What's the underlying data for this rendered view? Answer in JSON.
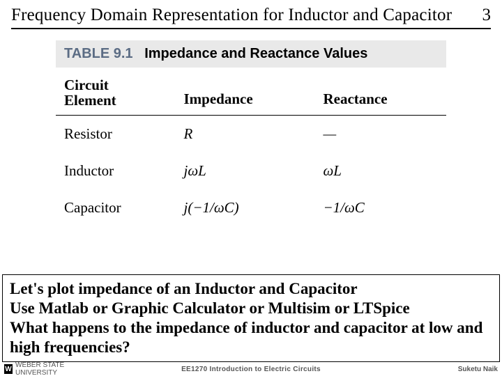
{
  "header": {
    "title": "Frequency Domain Representation for Inductor and Capacitor",
    "page_number": "3"
  },
  "table": {
    "caption_label": "TABLE 9.1",
    "caption_text": "Impedance and Reactance Values",
    "columns": {
      "col1_line1": "Circuit",
      "col1_line2": "Element",
      "col2": "Impedance",
      "col3": "Reactance"
    },
    "rows": [
      {
        "element": "Resistor",
        "impedance": "R",
        "reactance": "—"
      },
      {
        "element": "Inductor",
        "impedance": "jωL",
        "reactance": "ωL"
      },
      {
        "element": "Capacitor",
        "impedance": "j(−1/ωC)",
        "reactance": "−1/ωC"
      }
    ]
  },
  "callout": {
    "line1": "Let's plot impedance of an Inductor and Capacitor",
    "line2": "Use Matlab  or Graphic Calculator or Multisim or LTSpice",
    "line3": "What happens to the impedance of inductor and capacitor at low and high frequencies?"
  },
  "footer": {
    "left_text": "WEBER STATE UNIVERSITY",
    "center_text": "EE1270 Introduction to Electric Circuits",
    "right_text": "Suketu Naik"
  }
}
